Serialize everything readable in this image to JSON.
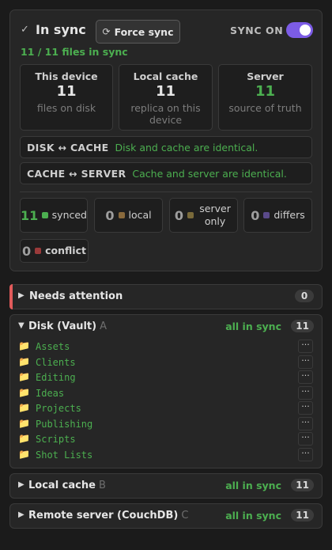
{
  "header": {
    "status_title": "In sync",
    "force_button": "Force sync",
    "sync_label": "SYNC ON",
    "sync_enabled": true,
    "files_summary": "11 / 11 files in sync"
  },
  "stats": [
    {
      "title": "This device",
      "value": "11",
      "desc": "files on disk"
    },
    {
      "title": "Local cache",
      "value": "11",
      "desc": "replica on this device"
    },
    {
      "title": "Server",
      "value": "11",
      "desc": "source of truth"
    }
  ],
  "comparisons": [
    {
      "label": "DISK ↔ CACHE",
      "message": "Disk and cache are identical."
    },
    {
      "label": "CACHE ↔ SERVER",
      "message": "Cache and server are identical."
    }
  ],
  "chips": [
    {
      "count": "11",
      "label": "synced",
      "color": "#4caf50"
    },
    {
      "count": "0",
      "label": "local",
      "color": "#8a6a3c"
    },
    {
      "count": "0",
      "label": "server only",
      "color": "#7a6a3a"
    },
    {
      "count": "0",
      "label": "differs",
      "color": "#5a4a8a"
    },
    {
      "count": "0",
      "label": "conflict",
      "color": "#9a3a3a"
    }
  ],
  "sections": {
    "attention": {
      "title": "Needs attention",
      "count": "0"
    },
    "disk": {
      "title": "Disk (Vault)",
      "letter": "A",
      "status": "all in sync",
      "count": "11",
      "files": [
        "Assets",
        "Clients",
        "Editing",
        "Ideas",
        "Projects",
        "Publishing",
        "Scripts",
        "Shot Lists"
      ]
    },
    "cache": {
      "title": "Local cache",
      "letter": "B",
      "status": "all in sync",
      "count": "11"
    },
    "remote": {
      "title": "Remote server (CouchDB)",
      "letter": "C",
      "status": "all in sync",
      "count": "11"
    }
  },
  "icons": {
    "check": "✓",
    "refresh": "⟳",
    "folder": "📁",
    "more": "···",
    "expanded": "▼",
    "collapsed": "▶"
  },
  "colors": {
    "accent": "#7c5ce6",
    "ok": "#4caf50",
    "attention": "#e25b5b"
  }
}
